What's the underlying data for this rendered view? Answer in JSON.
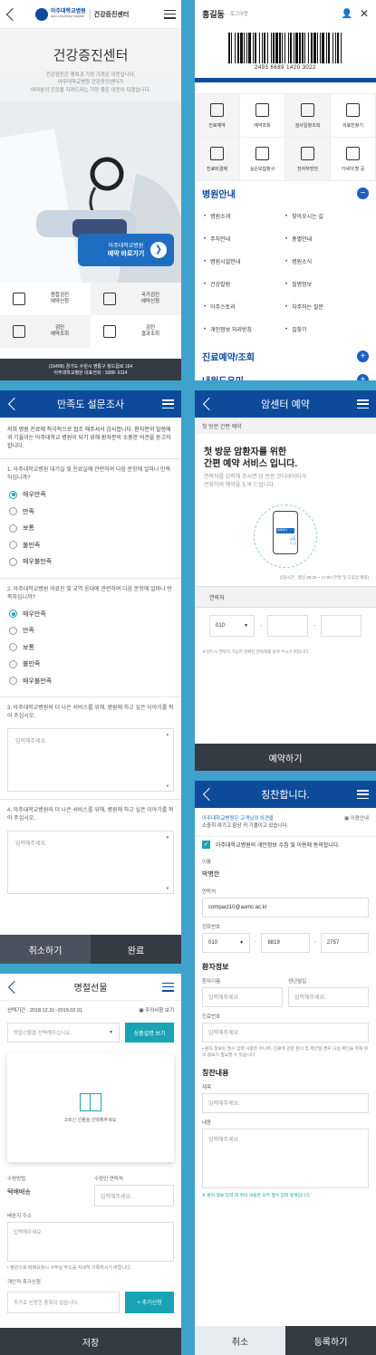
{
  "home": {
    "hospital_name": "아주대학교병원",
    "hospital_name_en": "Ajou University Hospital",
    "header_title": "건강증진센터",
    "hero_title": "건강증진센터",
    "hero_text_1": "건강검진은 행복과 가장 가까운 이웃입니다.",
    "hero_text_2": "아주대학교병원 건강증진센터가",
    "hero_text_3": "여러분의 건강을 지켜드리는 가장 좋은 이웃이 되겠습니다.",
    "cta_line1": "아주대학교병원",
    "cta_line2": "예약 바로가기",
    "grid": [
      {
        "label1": "종합검진",
        "label2": "예약신청"
      },
      {
        "label1": "국가검진",
        "label2": "예약신청"
      },
      {
        "label1": "검진",
        "label2": "예약조회"
      },
      {
        "label1": "검진",
        "label2": "결과조회"
      }
    ],
    "footer_line1": "(16499) 경기도 수원시 영통구 월드컵로 164",
    "footer_line2": "아주대학교병원 대표전화 : 1688- 6114"
  },
  "menu": {
    "user_name": "홍길동",
    "logout": "로그아웃",
    "barcode_number": "2493 6689 1420 3022",
    "quick": [
      "진료예약",
      "예약조회",
      "검사일정조회",
      "의료진찾기",
      "진료비결제",
      "실손보험청구",
      "전자처방전",
      "가셔야 할 곳"
    ],
    "section_title": "병원안내",
    "links": [
      "병원소개",
      "찾아오시는 길",
      "주차안내",
      "층별안내",
      "병원시설안내",
      "병원소식",
      "건강칼럼",
      "질병정보",
      "아주스토리",
      "자주하는 질문",
      "개인정보 처리방침",
      "길찾기"
    ],
    "section2_title": "진료예약/조회",
    "section3_title": "내원도우미"
  },
  "survey": {
    "title": "만족도 설문조사",
    "intro": "저희 병원 진료에 적극적으로 협조 해주셔서 감사합니다. 환자분의 말씀에 귀 기울이는 아주대학교 병원이 되기 위해 환자분의 소중한 의견을 듣고자 합니다.",
    "q1": "1. 아주대학교병원 대기실 및 진료실에 관련하여 다음 문항에 얼마나 만족하십니까?",
    "q2": "2. 아주대학교병원 의료진 및 교역 응대에 관련하여 다음 문항에 얼마나 만족하십니까?",
    "options": [
      "매우만족",
      "만족",
      "보통",
      "불만족",
      "매우불만족"
    ],
    "q3": "3. 아주대학교병원의 더 나은 서비스를 위해, 병원에 하고 싶은 이야기를 적어 주십시오.",
    "q4": "4. 아주대학교병원의 더 나은 서비스를 위해, 병원에 하고 싶은 이야기를 적어 주십시오.",
    "placeholder": "입력해주세요.",
    "cancel": "취소하기",
    "done": "완료"
  },
  "cancer": {
    "title": "암센터 예약",
    "sub": "첫 방문 간편 예약",
    "heading_1": "첫 방문 암환자를 위한",
    "heading_2": "간편 예약 서비스 입니다.",
    "desc_1": "연락처를 입력해 주시면 암 전문 코디네이터가",
    "desc_2": "전화하여 예약을 도와 드립니다.",
    "phone_btn": "예약하기",
    "hours": "상담시간 : 평일 08:30 ~ 17:00 (주말 및 공휴일 제외)",
    "contact_label": "연락처",
    "prefix": "010",
    "note": "※ 반드시 연락이 가능한 정확한 연락처를 남겨 주시기 바랍니다.",
    "submit": "예약하기"
  },
  "gift": {
    "title": "명절선물",
    "period": "선택기간 : 2018.12.31~2019.02.01",
    "caution": "주의사항 보기",
    "select_placeholder": "명절선물을 선택해주십시오.",
    "detail_btn": "상품설명 보기",
    "empty": "고르신 선물을 선택해주세요.",
    "ship_label": "수령방법",
    "ship_value": "택배배송",
    "phone_label": "수령인 연락처",
    "addr_label": "배송지 주소",
    "addr_note": "• 병원으로 택배요청시 사무실 주소를 자세히 기록하시기 바랍니다.",
    "extra_label": "개인적 추가신청",
    "extra_placeholder": "추가로 신청한 품목이 없습니다.",
    "extra_btn": "+ 추가신청",
    "placeholder": "입력해주세요.",
    "save": "저장"
  },
  "praise": {
    "title": "칭찬합니다.",
    "notice_1": "아주대학교병원은 고객님의 의견을",
    "notice_2": "소중히 여기고 항상 귀 기울이고 있습니다.",
    "guide": "이용안내",
    "agree": "아주대학교병원의 개인정보 수집 및 이용에 동의합니다.",
    "name_label": "이름",
    "name_value": "박병한",
    "contact_label": "연락처",
    "email_value": "compact10@aumc.ac.kr",
    "tel_label": "전화번호",
    "tel1": "010",
    "tel2": "8819",
    "tel3": "2757",
    "patient_title": "환자정보",
    "patient_name": "환자이름",
    "birth": "생년월일",
    "record_no": "진료번호",
    "patient_note": "• 환자 정보는 필수 입력 사항은 아니며, 진료에 관한 문의 및 제안일 경우 사실 확인을 위해 위의 정보가 필요할 수 있습니다.",
    "content_title": "칭찬내용",
    "subject": "제목",
    "body": "내용",
    "hint": "※ 환자 정보 입력 외 위의 내용은 모두 필수 입력 항목입니다.",
    "placeholder": "입력해주세요.",
    "cancel": "취소",
    "submit": "등록하기"
  },
  "colors": {
    "primary": "#0e4a9a",
    "teal": "#1aa3b5",
    "background": "#3fa2cc",
    "dark": "#333b45"
  }
}
